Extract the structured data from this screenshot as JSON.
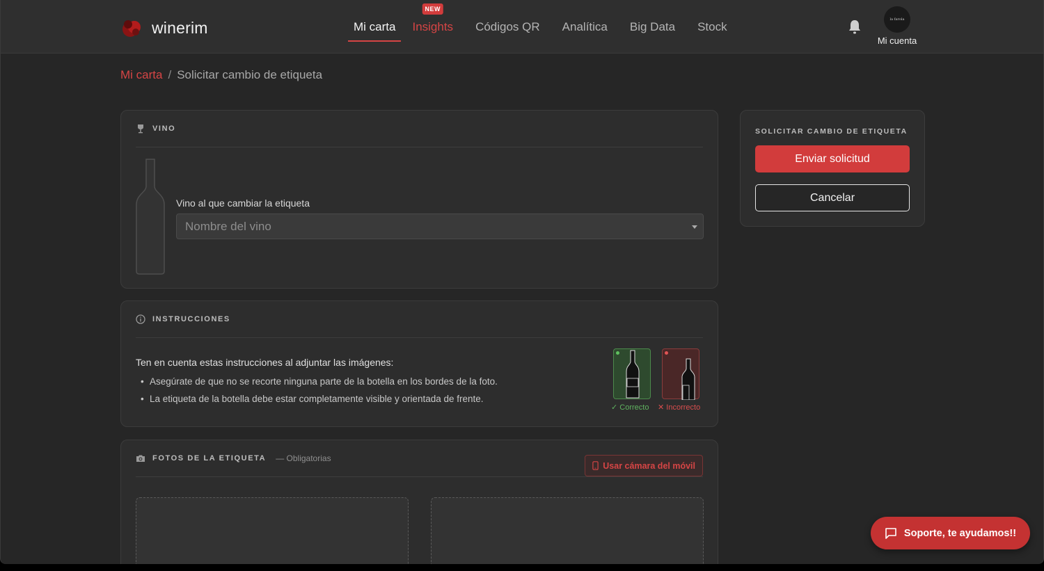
{
  "brand": {
    "name": "winerim"
  },
  "nav": {
    "items": [
      {
        "label": "Mi carta",
        "active": true
      },
      {
        "label": "Insights",
        "badge": "NEW",
        "highlight": true
      },
      {
        "label": "Códigos QR"
      },
      {
        "label": "Analítica"
      },
      {
        "label": "Big Data"
      },
      {
        "label": "Stock"
      }
    ]
  },
  "account": {
    "avatar_text": "la farola",
    "label": "Mi cuenta"
  },
  "breadcrumb": {
    "link": "Mi carta",
    "separator": "/",
    "current": "Solicitar cambio de etiqueta"
  },
  "wine_section": {
    "title": "VINO",
    "field_label": "Vino al que cambiar la etiqueta",
    "select_placeholder": "Nombre del vino"
  },
  "instructions": {
    "title": "INSTRUCCIONES",
    "lead": "Ten en cuenta estas instrucciones al adjuntar las imágenes:",
    "items": [
      "Asegúrate de que no se recorte ninguna parte de la botella en los bordes de la foto.",
      "La etiqueta de la botella debe estar completamente visible y orientada de frente."
    ],
    "correct_label": "✓ Correcto",
    "incorrect_label": "✕ Incorrecto"
  },
  "photos": {
    "title": "FOTOS DE LA ETIQUETA",
    "subtitle": "— Obligatorias",
    "camera_button": "Usar cámara del móvil"
  },
  "side_panel": {
    "title": "SOLICITAR CAMBIO DE ETIQUETA",
    "submit_label": "Enviar solicitud",
    "cancel_label": "Cancelar"
  },
  "support": {
    "label": "Soporte, te ayudamos!!"
  },
  "colors": {
    "accent": "#d64545",
    "background": "#262626",
    "card": "#2d2d2d",
    "correct": "#5fb35f",
    "incorrect": "#d94e4e"
  }
}
